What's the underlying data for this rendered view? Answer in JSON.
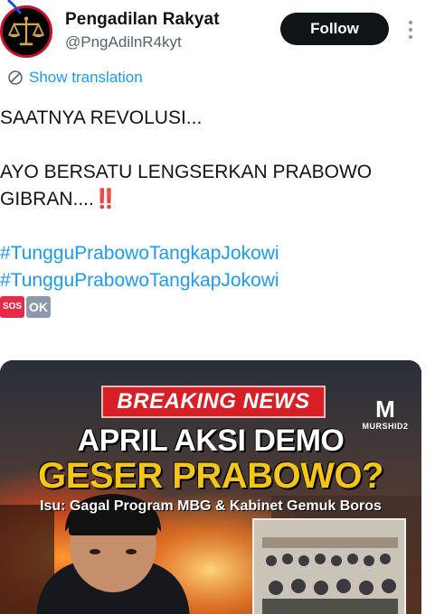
{
  "author": {
    "display_name": "Pengadilan Rakyat",
    "handle": "@PngAdilnR4kyt",
    "avatar_icon": "scales-of-justice-icon"
  },
  "actions": {
    "follow_label": "Follow",
    "more_icon": "more-vertical-icon"
  },
  "translation": {
    "label": "Show translation",
    "icon": "translate-icon"
  },
  "tweet": {
    "line1": "SAATNYA REVOLUSI...",
    "line2": "AYO BERSATU LENGSERKAN PRABOWO",
    "line3": "GIBRAN....",
    "line3_emoji": "‼️",
    "hashtag1": "#TungguPrabowoTangkapJokowi",
    "hashtag2": "#TungguPrabowoTangkapJokowi",
    "emoji_sos": "SOS",
    "emoji_ok": "OK"
  },
  "media": {
    "banner": "BREAKING NEWS",
    "logo_mark": "M",
    "logo_name": "MURSHID2",
    "headline1": "APRIL AKSI DEMO",
    "headline2": "GESER PRABOWO?",
    "subline": "Isu: Gagal Program MBG & Kabinet Gemuk Boros"
  },
  "colors": {
    "link": "#1d9bf0",
    "text": "#0f1419",
    "secondary": "#536471",
    "follow_bg": "#0f1419",
    "banner_red": "#d81f26",
    "headline_yellow": "#f5c518"
  }
}
